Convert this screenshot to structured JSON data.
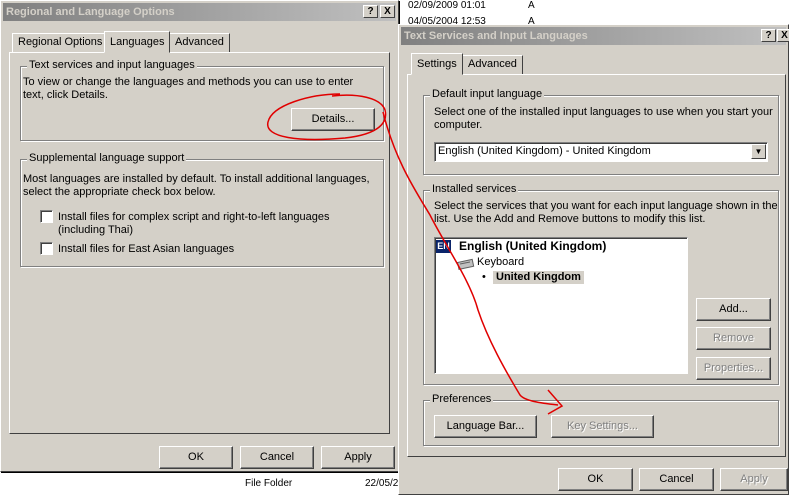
{
  "background": {
    "file_rows": [
      {
        "date": "02/09/2009 01:01",
        "attr": "A"
      },
      {
        "date": "04/05/2004 12:53",
        "attr": "A"
      }
    ],
    "bottom_items": [
      "File Folder",
      "22/05/2"
    ]
  },
  "regional": {
    "title": "Regional and Language Options",
    "help_glyph": "?",
    "close_glyph": "X",
    "tabs": [
      "Regional Options",
      "Languages",
      "Advanced"
    ],
    "active_tab": "Languages",
    "text_services": {
      "legend": "Text services and input languages",
      "description_line1": "To view or change the languages and methods you can use to enter",
      "description_line2": "text, click Details.",
      "details_button": "Details..."
    },
    "supplemental": {
      "legend": "Supplemental language support",
      "description_line1": "Most languages are installed by default. To install additional languages,",
      "description_line2": "select the appropriate check box below.",
      "complex_script_line1": "Install files for complex script and right-to-left languages",
      "complex_script_line2": "(including Thai)",
      "east_asian": "Install files for East Asian languages",
      "complex_checked": false,
      "east_asian_checked": false
    },
    "ok": "OK",
    "cancel": "Cancel",
    "apply": "Apply"
  },
  "text_services_dialog": {
    "title": "Text Services and Input Languages",
    "help_glyph": "?",
    "close_glyph": "X",
    "tabs": [
      "Settings",
      "Advanced"
    ],
    "active_tab": "Settings",
    "default_input": {
      "legend": "Default input language",
      "description_line1": "Select one of the installed input languages to use when you start your",
      "description_line2": "computer.",
      "selected": "English (United Kingdom) - United Kingdom",
      "arrow": "▼"
    },
    "installed": {
      "legend": "Installed services",
      "description_line1": "Select the services that you want for each input language shown in the",
      "description_line2": "list. Use the Add and Remove buttons to modify this list.",
      "badge": "EN",
      "language": "English (United Kingdom)",
      "keyboard": "Keyboard",
      "layout": "United Kingdom",
      "add": "Add...",
      "remove": "Remove",
      "properties": "Properties..."
    },
    "preferences": {
      "legend": "Preferences",
      "language_bar": "Language Bar...",
      "key_settings": "Key Settings..."
    },
    "ok": "OK",
    "cancel": "Cancel",
    "apply": "Apply"
  },
  "annotation_color": "#e00000"
}
